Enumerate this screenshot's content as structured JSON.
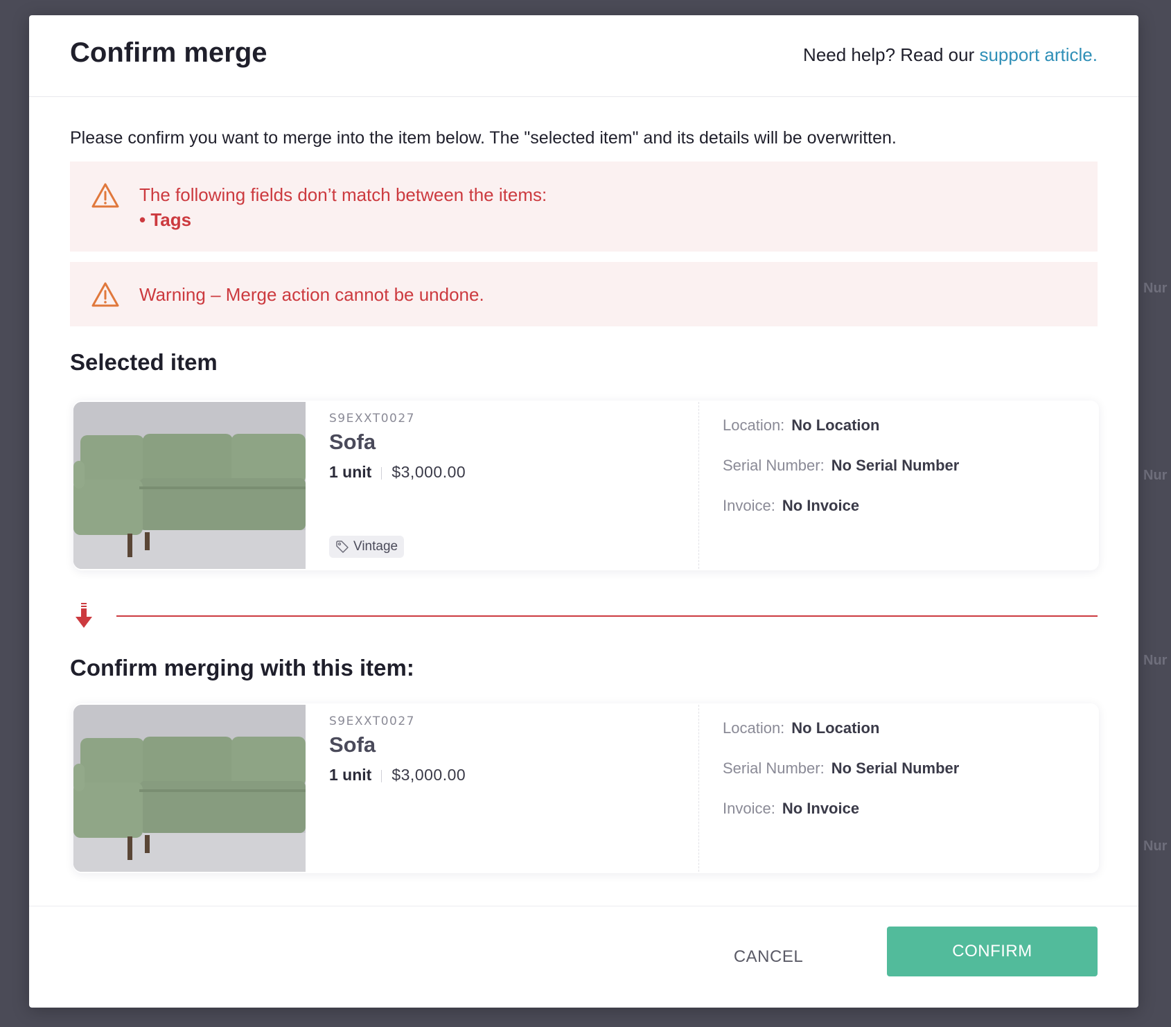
{
  "background": {
    "hints": [
      "Nur",
      "Nur",
      "Nur",
      "Nur"
    ]
  },
  "modal": {
    "title": "Confirm merge",
    "help_prefix": "Need help? Read our",
    "help_link": "support article.",
    "intro": "Please confirm you want to merge into the item below. The \"selected item\" and its details will be overwritten.",
    "alerts": {
      "mismatch_text": "The following fields don’t match between the items:",
      "mismatch_fields": [
        "• Tags"
      ],
      "undo_warning": "Warning – Merge action cannot be undone."
    },
    "selected_section_title": "Selected item",
    "merge_section_title": "Confirm merging with this item:",
    "items": [
      {
        "sku": "S9EXXT0027",
        "name": "Sofa",
        "qty": "1 unit",
        "price": "$3,000.00",
        "tag": "Vintage",
        "location_label": "Location:",
        "location_value": "No Location",
        "serial_label": "Serial Number:",
        "serial_value": "No Serial Number",
        "invoice_label": "Invoice:",
        "invoice_value": "No Invoice"
      },
      {
        "sku": "S9EXXT0027",
        "name": "Sofa",
        "qty": "1 unit",
        "price": "$3,000.00",
        "location_label": "Location:",
        "location_value": "No Location",
        "serial_label": "Serial Number:",
        "serial_value": "No Serial Number",
        "invoice_label": "Invoice:",
        "invoice_value": "No Invoice"
      }
    ],
    "footer": {
      "cancel_label": "CANCEL",
      "confirm_label": "CONFIRM"
    }
  },
  "colors": {
    "accent_teal": "#52bb9b",
    "alert_red": "#cc3a3f",
    "link_blue": "#2f8fb7",
    "warning_orange": "#e0783c"
  }
}
